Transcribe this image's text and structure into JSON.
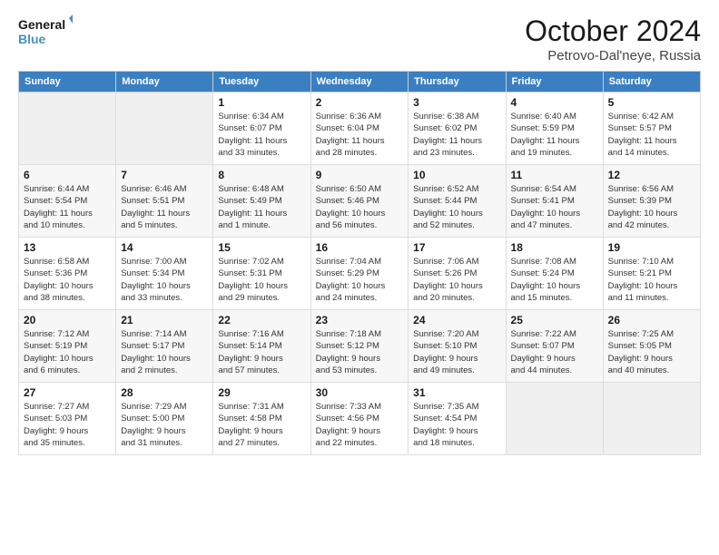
{
  "header": {
    "logo_line1": "General",
    "logo_line2": "Blue",
    "month": "October 2024",
    "location": "Petrovo-Dal'neye, Russia"
  },
  "weekdays": [
    "Sunday",
    "Monday",
    "Tuesday",
    "Wednesday",
    "Thursday",
    "Friday",
    "Saturday"
  ],
  "weeks": [
    [
      {
        "day": "",
        "info": ""
      },
      {
        "day": "",
        "info": ""
      },
      {
        "day": "1",
        "info": "Sunrise: 6:34 AM\nSunset: 6:07 PM\nDaylight: 11 hours\nand 33 minutes."
      },
      {
        "day": "2",
        "info": "Sunrise: 6:36 AM\nSunset: 6:04 PM\nDaylight: 11 hours\nand 28 minutes."
      },
      {
        "day": "3",
        "info": "Sunrise: 6:38 AM\nSunset: 6:02 PM\nDaylight: 11 hours\nand 23 minutes."
      },
      {
        "day": "4",
        "info": "Sunrise: 6:40 AM\nSunset: 5:59 PM\nDaylight: 11 hours\nand 19 minutes."
      },
      {
        "day": "5",
        "info": "Sunrise: 6:42 AM\nSunset: 5:57 PM\nDaylight: 11 hours\nand 14 minutes."
      }
    ],
    [
      {
        "day": "6",
        "info": "Sunrise: 6:44 AM\nSunset: 5:54 PM\nDaylight: 11 hours\nand 10 minutes."
      },
      {
        "day": "7",
        "info": "Sunrise: 6:46 AM\nSunset: 5:51 PM\nDaylight: 11 hours\nand 5 minutes."
      },
      {
        "day": "8",
        "info": "Sunrise: 6:48 AM\nSunset: 5:49 PM\nDaylight: 11 hours\nand 1 minute."
      },
      {
        "day": "9",
        "info": "Sunrise: 6:50 AM\nSunset: 5:46 PM\nDaylight: 10 hours\nand 56 minutes."
      },
      {
        "day": "10",
        "info": "Sunrise: 6:52 AM\nSunset: 5:44 PM\nDaylight: 10 hours\nand 52 minutes."
      },
      {
        "day": "11",
        "info": "Sunrise: 6:54 AM\nSunset: 5:41 PM\nDaylight: 10 hours\nand 47 minutes."
      },
      {
        "day": "12",
        "info": "Sunrise: 6:56 AM\nSunset: 5:39 PM\nDaylight: 10 hours\nand 42 minutes."
      }
    ],
    [
      {
        "day": "13",
        "info": "Sunrise: 6:58 AM\nSunset: 5:36 PM\nDaylight: 10 hours\nand 38 minutes."
      },
      {
        "day": "14",
        "info": "Sunrise: 7:00 AM\nSunset: 5:34 PM\nDaylight: 10 hours\nand 33 minutes."
      },
      {
        "day": "15",
        "info": "Sunrise: 7:02 AM\nSunset: 5:31 PM\nDaylight: 10 hours\nand 29 minutes."
      },
      {
        "day": "16",
        "info": "Sunrise: 7:04 AM\nSunset: 5:29 PM\nDaylight: 10 hours\nand 24 minutes."
      },
      {
        "day": "17",
        "info": "Sunrise: 7:06 AM\nSunset: 5:26 PM\nDaylight: 10 hours\nand 20 minutes."
      },
      {
        "day": "18",
        "info": "Sunrise: 7:08 AM\nSunset: 5:24 PM\nDaylight: 10 hours\nand 15 minutes."
      },
      {
        "day": "19",
        "info": "Sunrise: 7:10 AM\nSunset: 5:21 PM\nDaylight: 10 hours\nand 11 minutes."
      }
    ],
    [
      {
        "day": "20",
        "info": "Sunrise: 7:12 AM\nSunset: 5:19 PM\nDaylight: 10 hours\nand 6 minutes."
      },
      {
        "day": "21",
        "info": "Sunrise: 7:14 AM\nSunset: 5:17 PM\nDaylight: 10 hours\nand 2 minutes."
      },
      {
        "day": "22",
        "info": "Sunrise: 7:16 AM\nSunset: 5:14 PM\nDaylight: 9 hours\nand 57 minutes."
      },
      {
        "day": "23",
        "info": "Sunrise: 7:18 AM\nSunset: 5:12 PM\nDaylight: 9 hours\nand 53 minutes."
      },
      {
        "day": "24",
        "info": "Sunrise: 7:20 AM\nSunset: 5:10 PM\nDaylight: 9 hours\nand 49 minutes."
      },
      {
        "day": "25",
        "info": "Sunrise: 7:22 AM\nSunset: 5:07 PM\nDaylight: 9 hours\nand 44 minutes."
      },
      {
        "day": "26",
        "info": "Sunrise: 7:25 AM\nSunset: 5:05 PM\nDaylight: 9 hours\nand 40 minutes."
      }
    ],
    [
      {
        "day": "27",
        "info": "Sunrise: 7:27 AM\nSunset: 5:03 PM\nDaylight: 9 hours\nand 35 minutes."
      },
      {
        "day": "28",
        "info": "Sunrise: 7:29 AM\nSunset: 5:00 PM\nDaylight: 9 hours\nand 31 minutes."
      },
      {
        "day": "29",
        "info": "Sunrise: 7:31 AM\nSunset: 4:58 PM\nDaylight: 9 hours\nand 27 minutes."
      },
      {
        "day": "30",
        "info": "Sunrise: 7:33 AM\nSunset: 4:56 PM\nDaylight: 9 hours\nand 22 minutes."
      },
      {
        "day": "31",
        "info": "Sunrise: 7:35 AM\nSunset: 4:54 PM\nDaylight: 9 hours\nand 18 minutes."
      },
      {
        "day": "",
        "info": ""
      },
      {
        "day": "",
        "info": ""
      }
    ]
  ]
}
